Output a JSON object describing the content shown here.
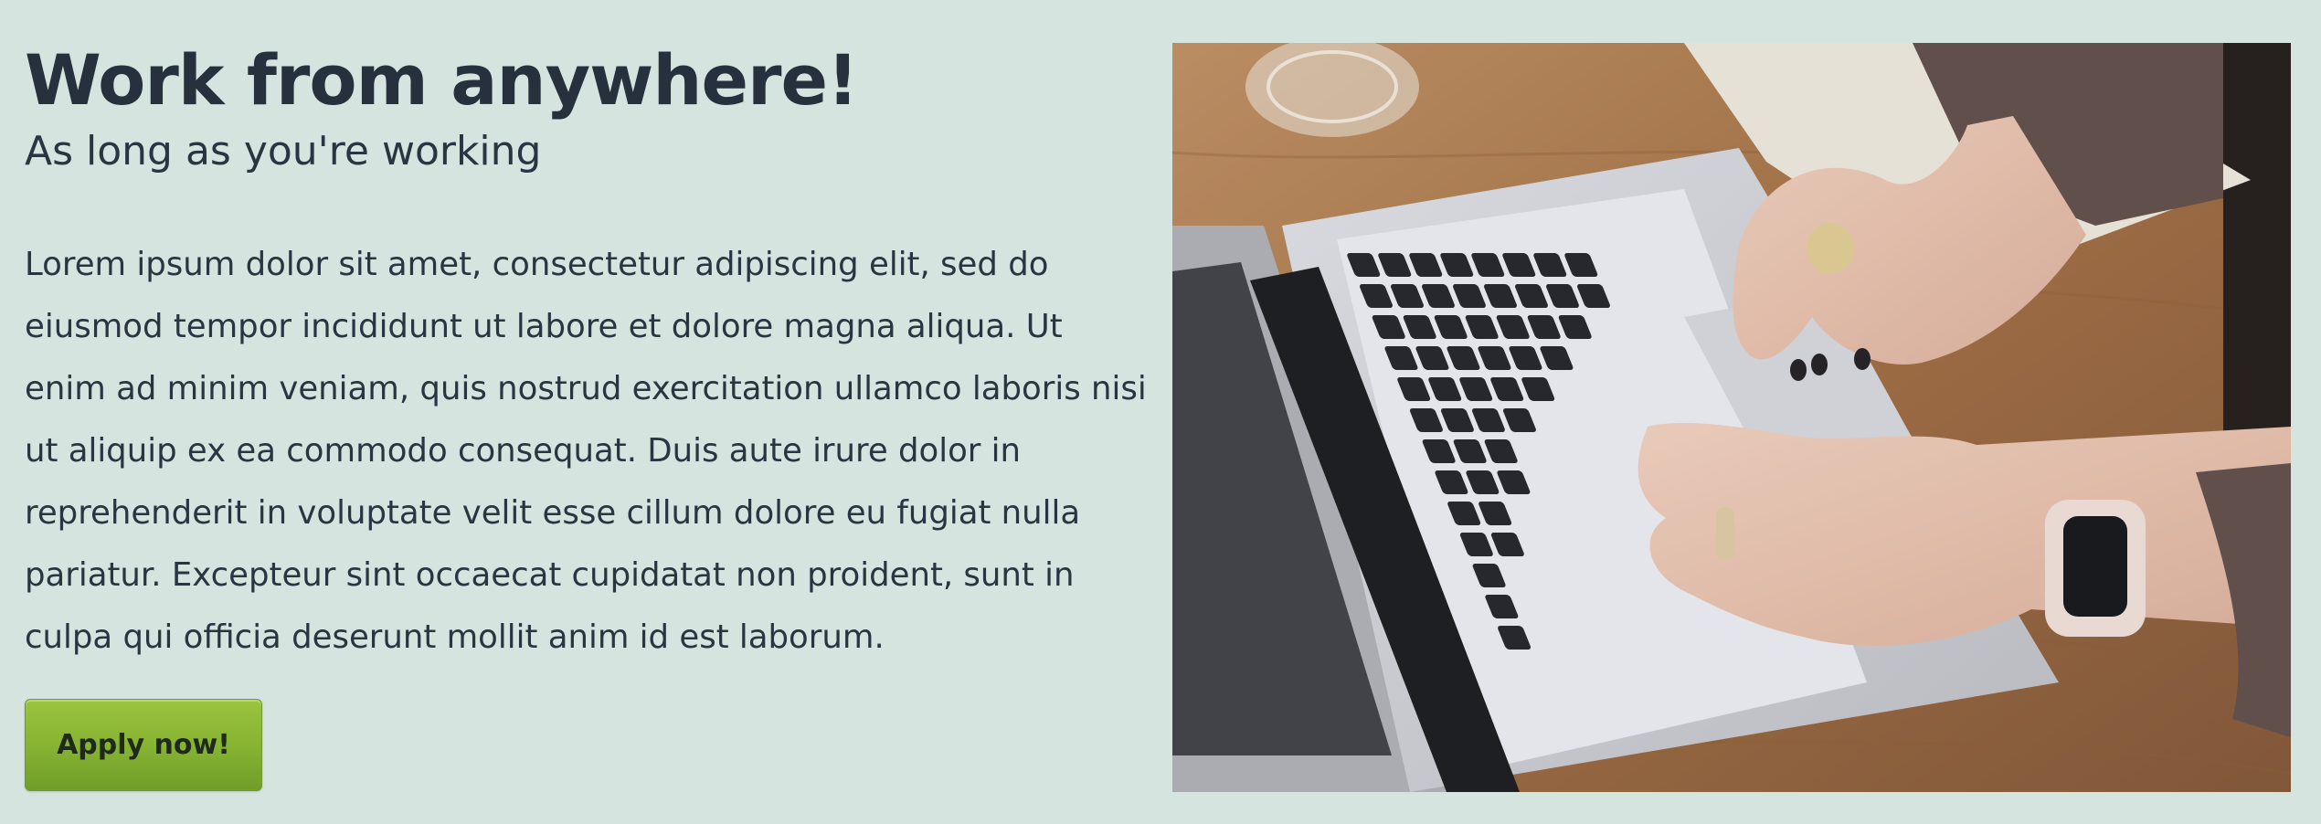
{
  "hero": {
    "title": "Work from anywhere!",
    "subtitle": "As long as you're working",
    "body": "Lorem ipsum dolor sit amet, consectetur adipiscing elit, sed do eiusmod tempor incididunt ut labore et dolore magna aliqua. Ut enim ad minim veniam, quis nostrud exercitation ullamco laboris nisi ut aliquip ex ea commodo consequat. Duis aute irure dolor in reprehenderit in voluptate velit esse cillum dolore eu fugiat nulla pariatur. Excepteur sint occaecat cupidatat non proident, sunt in culpa qui officia deserunt mollit anim id est laborum.",
    "cta_label": "Apply now!"
  },
  "photo": {
    "subject": "hands typing on a laptop keyboard on a wooden table"
  },
  "colors": {
    "background": "#d5e4de",
    "text": "#2b3441",
    "button": "#85b231"
  }
}
